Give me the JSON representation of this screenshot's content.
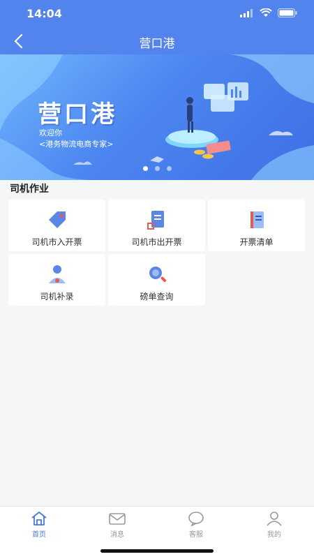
{
  "status_bar": {
    "time": "14:04"
  },
  "nav": {
    "title": "营口港"
  },
  "banner": {
    "title": "营口港",
    "line1": "欢迎你",
    "line2": "<港务物流电商专家>",
    "dots": 3,
    "active_dot": 1
  },
  "section": {
    "title": "司机作业"
  },
  "tiles": [
    {
      "label": "司机市入开票",
      "icon": "tag-icon"
    },
    {
      "label": "司机市出开票",
      "icon": "invoice-out-icon"
    },
    {
      "label": "开票清单",
      "icon": "list-doc-icon"
    },
    {
      "label": "司机补录",
      "icon": "person-icon"
    },
    {
      "label": "磅单查询",
      "icon": "magnifier-icon"
    }
  ],
  "tabbar": {
    "items": [
      {
        "label": "首页",
        "icon": "home-icon",
        "active": true
      },
      {
        "label": "消息",
        "icon": "mail-icon",
        "active": false
      },
      {
        "label": "客服",
        "icon": "chat-icon",
        "active": false
      },
      {
        "label": "我的",
        "icon": "user-icon",
        "active": false
      }
    ]
  },
  "colors": {
    "primary": "#5384ee",
    "active_tab": "#4a78d8",
    "tile_accent": "#e65b4f"
  }
}
